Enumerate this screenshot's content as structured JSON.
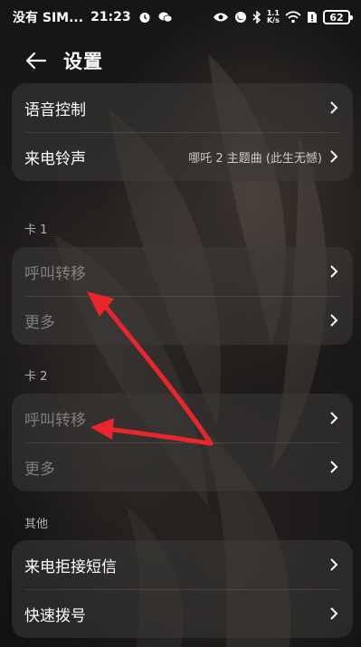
{
  "status_bar": {
    "carrier": "没有 SIM...",
    "time": "21:23",
    "net_rate_top": "1.1",
    "net_rate_bottom": "K/s",
    "battery": "62"
  },
  "header": {
    "title": "设置"
  },
  "top_group": {
    "items": [
      {
        "label": "语音控制",
        "value": ""
      },
      {
        "label": "来电铃声",
        "value": "哪吒 2 主题曲 (此生无憾)"
      }
    ]
  },
  "card1": {
    "section": "卡 1",
    "items": [
      {
        "label": "呼叫转移"
      },
      {
        "label": "更多"
      }
    ]
  },
  "card2": {
    "section": "卡 2",
    "items": [
      {
        "label": "呼叫转移"
      },
      {
        "label": "更多"
      }
    ]
  },
  "other": {
    "section": "其他",
    "items": [
      {
        "label": "来电拒接短信"
      },
      {
        "label": "快速拨号"
      }
    ]
  },
  "colors": {
    "annotation_arrow": "#e8262b",
    "card_bg": "#3c3a38",
    "text": "#ffffff"
  }
}
